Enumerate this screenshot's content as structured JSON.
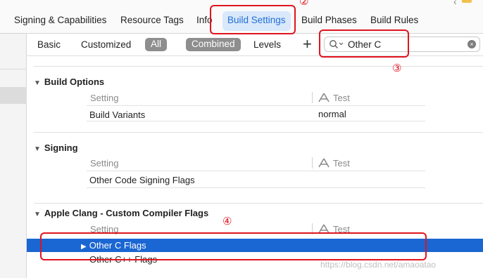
{
  "tabs": [
    {
      "label": "Signing & Capabilities"
    },
    {
      "label": "Resource Tags"
    },
    {
      "label": "Info"
    },
    {
      "label": "Build Settings"
    },
    {
      "label": "Build Phases"
    },
    {
      "label": "Build Rules"
    }
  ],
  "filter": {
    "basic": "Basic",
    "customized": "Customized",
    "all": "All",
    "combined": "Combined",
    "levels": "Levels",
    "add": "+",
    "search_value": "Other C",
    "clear": "×"
  },
  "sections": [
    {
      "title": "Build Options",
      "col_setting": "Setting",
      "col_target": "Test",
      "rows": [
        {
          "name": "Build Variants",
          "value": "normal"
        }
      ]
    },
    {
      "title": "Signing",
      "col_setting": "Setting",
      "col_target": "Test",
      "rows": [
        {
          "name": "Other Code Signing Flags",
          "value": ""
        }
      ]
    },
    {
      "title": "Apple Clang - Custom Compiler Flags",
      "col_setting": "Setting",
      "col_target": "Test",
      "rows": [
        {
          "name": "Other C Flags",
          "value": "",
          "selected": true
        },
        {
          "name": "Other C++ Flags",
          "value": ""
        }
      ]
    }
  ],
  "annotations": {
    "n2": "②",
    "n3": "③",
    "n4": "④"
  },
  "watermark": "https://blog.csdn.net/amaoatao",
  "colors": {
    "accent": "#1a66d2",
    "annotation": "#e0141e",
    "active_tab_bg": "#d9e8fb"
  }
}
